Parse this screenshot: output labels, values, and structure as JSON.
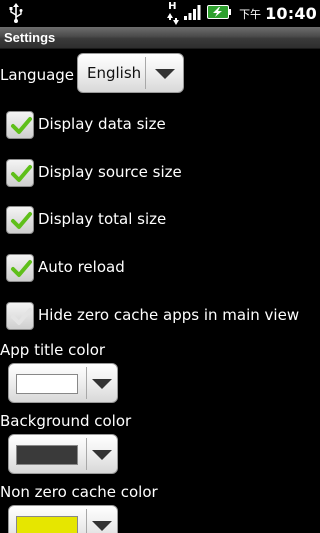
{
  "status_bar": {
    "usb_icon": "usb-icon",
    "network_letter": "H",
    "signal_icon": "signal-bars-icon",
    "battery_icon": "battery-charging-icon",
    "ampm": "下午",
    "time": "10:40"
  },
  "title": "Settings",
  "language": {
    "label": "Language",
    "value": "English"
  },
  "checkboxes": [
    {
      "label": "Display data size",
      "checked": true
    },
    {
      "label": "Display source size",
      "checked": true
    },
    {
      "label": "Display total size",
      "checked": true
    },
    {
      "label": "Auto reload",
      "checked": true
    },
    {
      "label": "Hide zero cache apps in main view",
      "checked": false
    }
  ],
  "colors": [
    {
      "label": "App title color",
      "swatch": "#ffffff"
    },
    {
      "label": "Background color",
      "swatch": "#3a3a3a"
    },
    {
      "label": "Non zero cache color",
      "swatch": "#e6e600"
    }
  ]
}
